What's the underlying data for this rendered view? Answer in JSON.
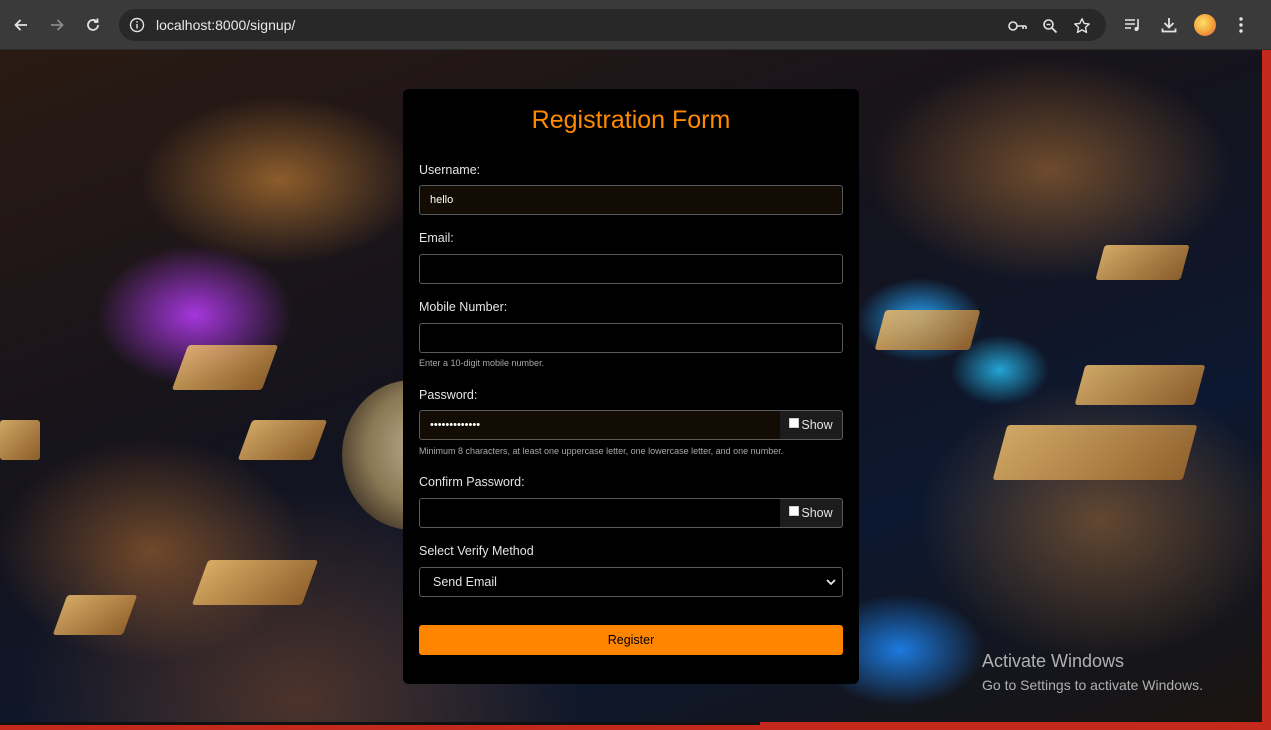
{
  "browser": {
    "url": "localhost:8000/signup/"
  },
  "form": {
    "title": "Registration Form",
    "username": {
      "label": "Username:",
      "value": "hello"
    },
    "email": {
      "label": "Email:",
      "value": ""
    },
    "mobile": {
      "label": "Mobile Number:",
      "value": "",
      "help": "Enter a 10-digit mobile number."
    },
    "password": {
      "label": "Password:",
      "value": "•••••••••••••",
      "show_label": "Show",
      "help": "Minimum 8 characters, at least one uppercase letter, one lowercase letter, and one number."
    },
    "confirm_password": {
      "label": "Confirm Password:",
      "value": "",
      "show_label": "Show"
    },
    "verify_method": {
      "label": "Select Verify Method",
      "selected": "Send Email"
    },
    "submit_label": "Register",
    "accent_color": "#ff8500"
  },
  "watermark": {
    "title": "Activate Windows",
    "subtitle": "Go to Settings to activate Windows."
  }
}
